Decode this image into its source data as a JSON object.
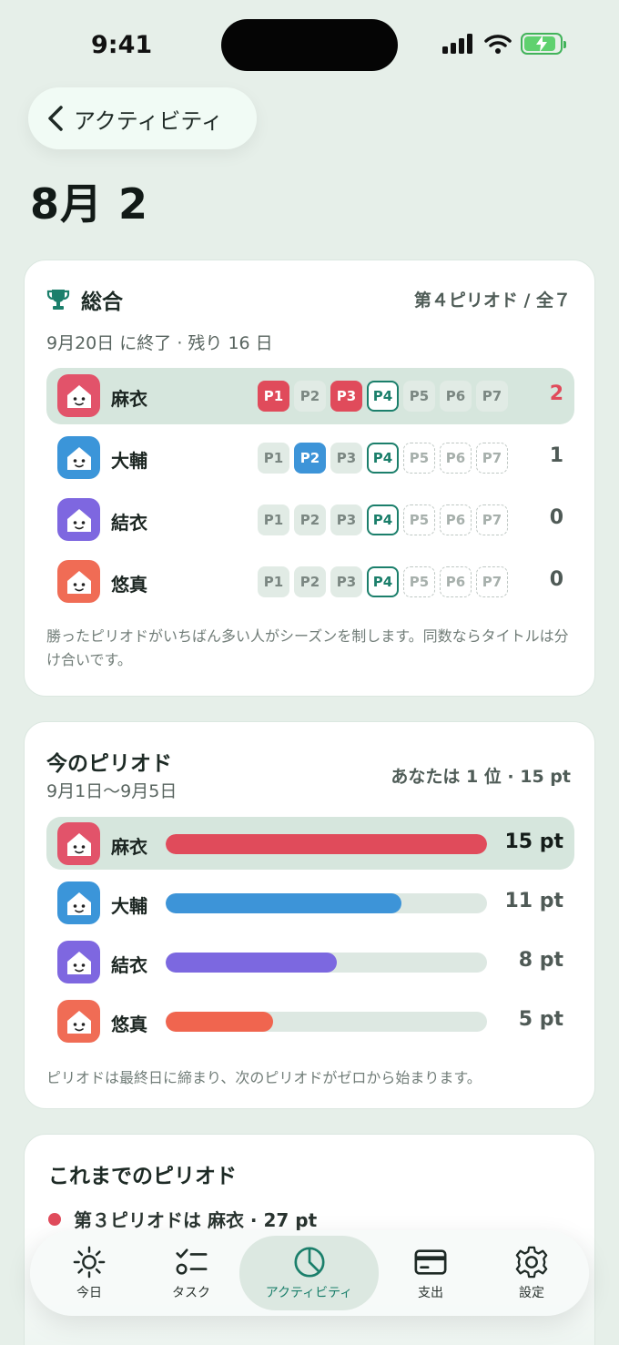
{
  "status": {
    "time": "9:41"
  },
  "nav": {
    "back_label": "アクティビティ"
  },
  "page": {
    "title": "8月 2"
  },
  "overall": {
    "title": "総合",
    "period_progress": "第４ピリオド / 全７",
    "subtitle": "9月20日 に終了 · 残り 16 日",
    "note": "勝ったピリオドがいちばん多い人がシーズンを制します。同数ならタイトルは分け合いです。",
    "rows": [
      {
        "name": "麻衣",
        "score": "2",
        "me": true,
        "avatar_color": "#e2536a",
        "chips": [
          {
            "label": "P1",
            "state": "win-red"
          },
          {
            "label": "P2",
            "state": "past"
          },
          {
            "label": "P3",
            "state": "win-red"
          },
          {
            "label": "P4",
            "state": "current"
          },
          {
            "label": "P5",
            "state": "past"
          },
          {
            "label": "P6",
            "state": "past"
          },
          {
            "label": "P7",
            "state": "past"
          }
        ]
      },
      {
        "name": "大輔",
        "score": "1",
        "me": false,
        "avatar_color": "#3b95d9",
        "chips": [
          {
            "label": "P1",
            "state": "past"
          },
          {
            "label": "P2",
            "state": "win-blue"
          },
          {
            "label": "P3",
            "state": "past"
          },
          {
            "label": "P4",
            "state": "current"
          },
          {
            "label": "P5",
            "state": "future"
          },
          {
            "label": "P6",
            "state": "future"
          },
          {
            "label": "P7",
            "state": "future"
          }
        ]
      },
      {
        "name": "結衣",
        "score": "0",
        "me": false,
        "avatar_color": "#7e67e0",
        "chips": [
          {
            "label": "P1",
            "state": "past"
          },
          {
            "label": "P2",
            "state": "past"
          },
          {
            "label": "P3",
            "state": "past"
          },
          {
            "label": "P4",
            "state": "current"
          },
          {
            "label": "P5",
            "state": "future"
          },
          {
            "label": "P6",
            "state": "future"
          },
          {
            "label": "P7",
            "state": "future"
          }
        ]
      },
      {
        "name": "悠真",
        "score": "0",
        "me": false,
        "avatar_color": "#f06c55",
        "chips": [
          {
            "label": "P1",
            "state": "past"
          },
          {
            "label": "P2",
            "state": "past"
          },
          {
            "label": "P3",
            "state": "past"
          },
          {
            "label": "P4",
            "state": "current"
          },
          {
            "label": "P5",
            "state": "future"
          },
          {
            "label": "P6",
            "state": "future"
          },
          {
            "label": "P7",
            "state": "future"
          }
        ]
      }
    ]
  },
  "current_period": {
    "title": "今のピリオド",
    "dates": "9月1日〜9月5日",
    "my_rank": "あなたは 1 位 · 15 pt",
    "note": "ピリオドは最終日に締まり、次のピリオドがゼロから始まります。",
    "max_points": 15,
    "rows": [
      {
        "name": "麻衣",
        "points": 15,
        "label": "15 pt",
        "me": true,
        "color": "#e04b5b",
        "avatar_color": "#e2536a"
      },
      {
        "name": "大輔",
        "points": 11,
        "label": "11 pt",
        "me": false,
        "color": "#3d94d8",
        "avatar_color": "#3b95d9"
      },
      {
        "name": "結衣",
        "points": 8,
        "label": "8 pt",
        "me": false,
        "color": "#7c68e0",
        "avatar_color": "#7e67e0"
      },
      {
        "name": "悠真",
        "points": 5,
        "label": "5 pt",
        "me": false,
        "color": "#f0654f",
        "avatar_color": "#f06c55"
      }
    ]
  },
  "history": {
    "title": "これまでのピリオド",
    "items": [
      {
        "text": "第３ピリオドは 麻衣 · 27 pt",
        "color": "#e04b5b"
      }
    ]
  },
  "tabs": [
    {
      "label": "今日",
      "icon": "sun-icon",
      "active": false
    },
    {
      "label": "タスク",
      "icon": "checklist-icon",
      "active": false
    },
    {
      "label": "アクティビティ",
      "icon": "pie-chart-icon",
      "active": true
    },
    {
      "label": "支出",
      "icon": "credit-card-icon",
      "active": false
    },
    {
      "label": "設定",
      "icon": "gear-icon",
      "active": false
    }
  ],
  "colors": {
    "accent": "#1b7f6b",
    "background": "#e6efe9",
    "win_red": "#e04b5b",
    "win_blue": "#3d94d8"
  }
}
